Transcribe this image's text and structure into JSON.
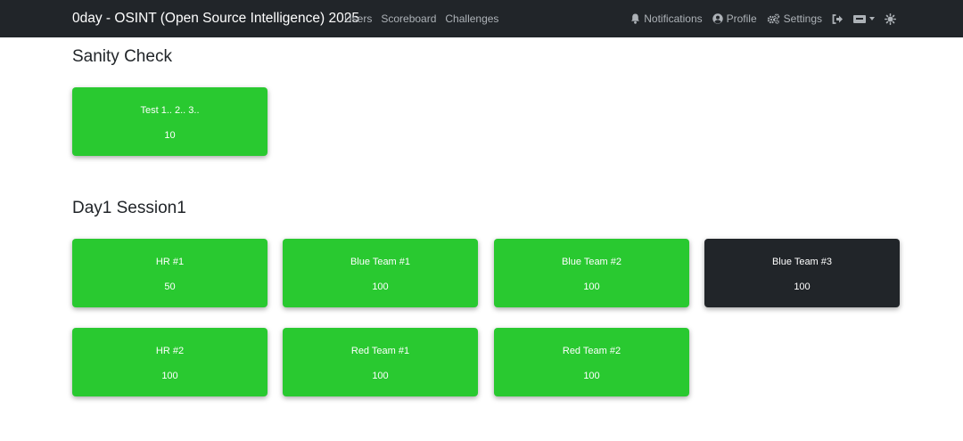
{
  "navbar": {
    "brand": "0day - OSINT (Open Source Intelligence) 2025",
    "links": [
      {
        "label": "Users"
      },
      {
        "label": "Scoreboard"
      },
      {
        "label": "Challenges"
      }
    ],
    "right": {
      "notifications_label": "Notifications",
      "profile_label": "Profile",
      "settings_label": "Settings",
      "notifications_icon": "bell-icon",
      "profile_icon": "user-circle-icon",
      "settings_icon": "cogs-icon",
      "logout_icon": "sign-out-icon",
      "language_icon": "language-icon",
      "theme_icon": "sun-icon"
    }
  },
  "colors": {
    "navbar_bg": "#212529",
    "card_unsolved": "#29c930",
    "card_solved": "#212529"
  },
  "sections": [
    {
      "title": "Sanity Check",
      "challenges": [
        {
          "name": "Test 1.. 2.. 3..",
          "value": "10",
          "solved": false
        }
      ]
    },
    {
      "title": "Day1 Session1",
      "challenges": [
        {
          "name": "HR #1",
          "value": "50",
          "solved": false
        },
        {
          "name": "Blue Team #1",
          "value": "100",
          "solved": false
        },
        {
          "name": "Blue Team #2",
          "value": "100",
          "solved": false
        },
        {
          "name": "Blue Team #3",
          "value": "100",
          "solved": true
        },
        {
          "name": "HR #2",
          "value": "100",
          "solved": false
        },
        {
          "name": "Red Team #1",
          "value": "100",
          "solved": false
        },
        {
          "name": "Red Team #2",
          "value": "100",
          "solved": false
        }
      ]
    }
  ]
}
